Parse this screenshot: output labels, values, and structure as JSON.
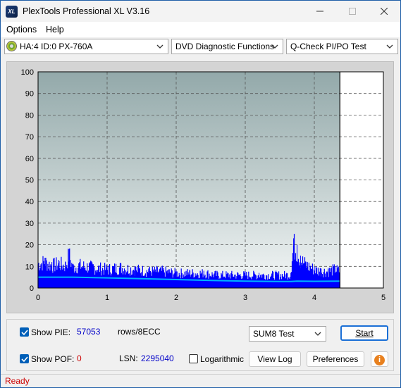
{
  "window": {
    "title": "PlexTools Professional XL V3.16",
    "icon_text": "XL"
  },
  "menu": {
    "items": [
      "Options",
      "Help"
    ]
  },
  "toolbar": {
    "drive": "HA:4 ID:0  PX-760A",
    "function": "DVD Diagnostic Functions",
    "test": "Q-Check PI/PO Test"
  },
  "chart_data": {
    "type": "area",
    "x_ticks": [
      "0",
      "1",
      "2",
      "3",
      "4",
      "5"
    ],
    "y_ticks": [
      "0",
      "10",
      "20",
      "30",
      "40",
      "50",
      "60",
      "70",
      "80",
      "90",
      "100"
    ],
    "xlim": [
      0,
      5
    ],
    "ylim": [
      0,
      100
    ],
    "grid": true,
    "data_end_x": 4.37,
    "series": [
      {
        "color": "#0000ff",
        "kind": "pie_bars",
        "x": [
          0.0,
          0.1,
          0.2,
          0.3,
          0.4,
          0.45,
          0.5,
          0.6,
          0.8,
          1.0,
          1.2,
          1.4,
          1.6,
          1.8,
          2.0,
          2.2,
          2.4,
          2.6,
          2.8,
          3.0,
          3.2,
          3.4,
          3.6,
          3.66,
          3.7,
          3.75,
          3.8,
          3.9,
          4.0,
          4.1,
          4.2,
          4.3,
          4.37
        ],
        "y": [
          13,
          14,
          12,
          13,
          12,
          18,
          11,
          12,
          11,
          10,
          11,
          10,
          9,
          9,
          8,
          8,
          8,
          7,
          7,
          7,
          7,
          7,
          7,
          7,
          23,
          20,
          15,
          12,
          10,
          9,
          9,
          10,
          9
        ]
      },
      {
        "color": "#00b4ff",
        "kind": "sum_line",
        "x": [
          0.0,
          0.5,
          1.0,
          1.5,
          2.0,
          2.5,
          3.0,
          3.5,
          3.66,
          3.75,
          4.0,
          4.37
        ],
        "y": [
          5,
          5,
          4.7,
          4.3,
          3.9,
          3.5,
          3.2,
          3.0,
          3.0,
          3.2,
          3.1,
          3.2
        ]
      }
    ]
  },
  "controls": {
    "show_pie_label": "Show PIE:",
    "pie_value": "57053",
    "pie_unit": "rows/8ECC",
    "show_pof_label": "Show POF:",
    "pof_value": "0",
    "lsn_label": "LSN:",
    "lsn_value": "2295040",
    "logarithmic_label": "Logarithmic",
    "test_mode": "SUM8 Test",
    "start_label": "Start",
    "view_log_label": "View Log",
    "preferences_label": "Preferences",
    "info_glyph": "i"
  },
  "status": {
    "text": "Ready"
  },
  "colors": {
    "pie_value": "#0000c8",
    "pof_value": "#cc0000",
    "status_text": "#cc0000",
    "accent": "#005fb8"
  }
}
